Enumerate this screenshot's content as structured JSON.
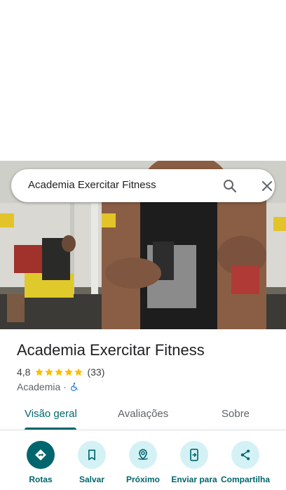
{
  "search": {
    "query": "Academia Exercitar Fitness"
  },
  "place": {
    "name": "Academia Exercitar Fitness",
    "rating": "4,8",
    "stars": 5,
    "review_count": "(33)",
    "category": "Academia",
    "separator": "·"
  },
  "tabs": [
    {
      "label": "Visão geral",
      "active": true
    },
    {
      "label": "Avaliações",
      "active": false
    },
    {
      "label": "Sobre",
      "active": false
    }
  ],
  "actions": [
    {
      "label": "Rotas",
      "icon": "directions-icon"
    },
    {
      "label": "Salvar",
      "icon": "bookmark-icon"
    },
    {
      "label": "Próximo",
      "icon": "nearby-icon"
    },
    {
      "label": "Enviar para",
      "icon": "send-to-phone-icon"
    },
    {
      "label": "Compartilha",
      "icon": "share-icon"
    }
  ],
  "colors": {
    "accent": "#00666e",
    "action_bg": "#d4f2f6",
    "star": "#fbbc04",
    "text": "#202124",
    "secondary_text": "#5f6368",
    "accessibility_blue": "#1a73e8"
  }
}
